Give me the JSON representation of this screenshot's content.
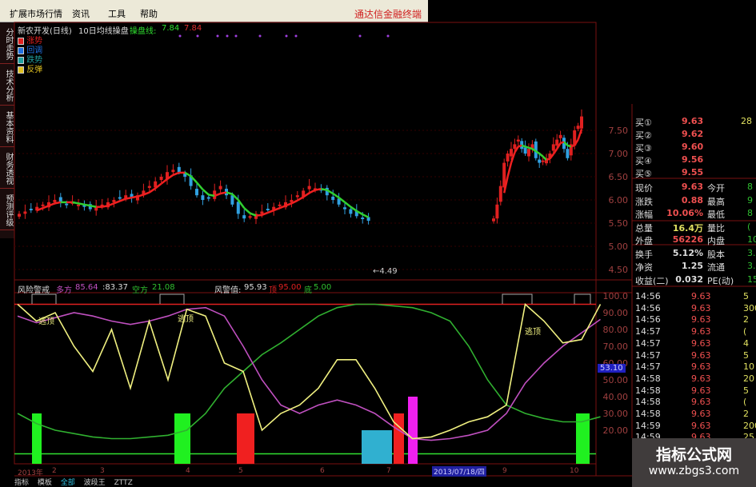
{
  "menu": {
    "items": [
      "扩展市场行情",
      "资讯",
      "工具",
      "帮助"
    ],
    "brand": "通达信金融终端"
  },
  "sidebar": {
    "tabs": [
      "分时走势",
      "技术分析",
      "基本资料",
      "财务透视",
      "预测评级"
    ]
  },
  "main_chart": {
    "title": "新农开发(日线)",
    "indicator": "10日均线操盘",
    "line_label": "操盘线:",
    "line_value": "7.84",
    "line_value2": "7.84",
    "legend": [
      {
        "label": "涨势",
        "color": "#e02020"
      },
      {
        "label": "回调",
        "color": "#2070e0"
      },
      {
        "label": "跌势",
        "color": "#20a0a0"
      },
      {
        "label": "反弹",
        "color": "#e0c020"
      }
    ],
    "price_ticks": [
      "7.50",
      "7.00",
      "6.50",
      "6.00",
      "5.50",
      "5.00",
      "4.50"
    ],
    "low_marker": "←4.49"
  },
  "indicator_panel": {
    "name": "风险警戒",
    "bull_label": "多方",
    "bull_value": "85.64",
    "v2": ":83.37",
    "bear_label": "空方",
    "bear_value": "21.08",
    "warn_label": "风警值:",
    "warn_value": "95.93",
    "top_label": "顶",
    "top_value": "95.00",
    "bottom_label": "底",
    "bottom_value": "5.00",
    "annot": [
      "逃顶",
      "逃顶",
      "逃顶"
    ],
    "y_ticks": [
      "100.0",
      "90.00",
      "80.00",
      "70.00",
      "60.00",
      "50.00",
      "40.00",
      "30.00",
      "20.00"
    ],
    "cursor_value": "53.10"
  },
  "x_axis": {
    "labels": [
      "2013年",
      "2",
      "3",
      "4",
      "5",
      "6",
      "7",
      "9",
      "10"
    ],
    "cursor_date": "2013/07/18/四"
  },
  "bottom_tabs": [
    "指标",
    "模板",
    "全部",
    "波段王",
    "ZTTZ"
  ],
  "chart_data": {
    "type": "candlestick+line",
    "segment1_closes": [
      5.7,
      5.75,
      5.8,
      5.85,
      5.9,
      5.95,
      6.0,
      5.95,
      5.9,
      5.95,
      5.9,
      5.85,
      5.8,
      5.85,
      5.9,
      5.95,
      6.0,
      6.05,
      6.1,
      6.05,
      6.1,
      6.2,
      6.3,
      6.4,
      6.5,
      6.6,
      6.65,
      6.6,
      6.5,
      6.3,
      6.1,
      6.0,
      6.05,
      6.2,
      6.3,
      6.1,
      5.9,
      5.7,
      5.6,
      5.65,
      5.7,
      5.75,
      5.8,
      5.85,
      5.9,
      5.95,
      6.0,
      6.1,
      6.2,
      6.3,
      6.25,
      6.2,
      6.1,
      6.0,
      5.9,
      5.8,
      5.7,
      5.65,
      5.6,
      5.55
    ],
    "segment2_closes": [
      5.6,
      5.9,
      6.3,
      6.8,
      7.0,
      7.1,
      7.2,
      7.3,
      7.1,
      7.0,
      7.1,
      7.2,
      6.9,
      6.8,
      6.85,
      6.9,
      7.0,
      7.2,
      7.3,
      7.4,
      7.1,
      6.9,
      7.2,
      7.5,
      7.6,
      7.8
    ],
    "yellow": [
      95,
      85,
      90,
      70,
      55,
      80,
      45,
      85,
      50,
      92,
      88,
      60,
      55,
      20,
      30,
      35,
      45,
      62,
      62,
      45,
      25,
      15,
      16,
      20,
      25,
      28,
      35,
      95,
      85,
      72,
      74,
      95
    ],
    "purple": [
      88,
      84,
      87,
      90,
      88,
      85,
      83,
      85,
      88,
      92,
      93,
      88,
      70,
      50,
      35,
      30,
      35,
      38,
      35,
      30,
      22,
      15,
      14,
      15,
      17,
      20,
      30,
      48,
      60,
      70,
      78,
      86
    ],
    "green": [
      30,
      24,
      20,
      18,
      16,
      15,
      15,
      16,
      17,
      20,
      30,
      45,
      55,
      65,
      72,
      80,
      88,
      93,
      95,
      95,
      94,
      93,
      90,
      85,
      70,
      50,
      35,
      30,
      27,
      25,
      25,
      28
    ],
    "bars": [
      {
        "color": "#20f020",
        "value": 30
      },
      {
        "color": "#20f020",
        "value": 30
      },
      {
        "color": "#f02020",
        "value": 30
      },
      {
        "color": "#30b0d0",
        "value": 20
      },
      {
        "color": "#f02020",
        "value": 30
      },
      {
        "color": "#f020f0",
        "value": 40
      },
      {
        "color": "#20f020",
        "value": 30
      }
    ],
    "ylim": [
      0,
      100
    ],
    "top_line": 95,
    "bottom_line": 5
  },
  "quote": {
    "bids": [
      {
        "label": "买①",
        "price": "9.63",
        "vol": "28"
      },
      {
        "label": "买②",
        "price": "9.62"
      },
      {
        "label": "买③",
        "price": "9.60"
      },
      {
        "label": "买④",
        "price": "9.56"
      },
      {
        "label": "买⑤",
        "price": "9.55"
      }
    ],
    "stats": [
      {
        "l": "现价",
        "v": "9.63",
        "l2": "今开",
        "v2": "8"
      },
      {
        "l": "涨跌",
        "v": "0.88",
        "l2": "最高",
        "v2": "9"
      },
      {
        "l": "涨幅",
        "v": "10.06%",
        "l2": "最低",
        "v2": "8"
      },
      {
        "l": "总量",
        "v": "16.4万",
        "l2": "量比",
        "v2": "("
      },
      {
        "l": "外盘",
        "v": "56226",
        "l2": "内盘",
        "v2": "10."
      },
      {
        "l": "换手",
        "v": "5.12%",
        "l2": "股本",
        "v2": "3.2"
      },
      {
        "l": "净资",
        "v": "1.25",
        "l2": "流通",
        "v2": "3.2"
      },
      {
        "l": "收益(二)",
        "v": "0.032",
        "l2": "PE(动)",
        "v2": "15"
      }
    ],
    "ticks": [
      {
        "t": "14:56",
        "p": "9.63",
        "v": "5"
      },
      {
        "t": "14:56",
        "p": "9.63",
        "v": "300"
      },
      {
        "t": "14:56",
        "p": "9.63",
        "v": "2"
      },
      {
        "t": "14:57",
        "p": "9.63",
        "v": "("
      },
      {
        "t": "14:57",
        "p": "9.63",
        "v": "4"
      },
      {
        "t": "14:57",
        "p": "9.63",
        "v": "5"
      },
      {
        "t": "14:57",
        "p": "9.63",
        "v": "10"
      },
      {
        "t": "14:58",
        "p": "9.63",
        "v": "20"
      },
      {
        "t": "14:58",
        "p": "9.63",
        "v": "5"
      },
      {
        "t": "14:58",
        "p": "9.63",
        "v": "("
      },
      {
        "t": "14:58",
        "p": "9.63",
        "v": "2"
      },
      {
        "t": "14:59",
        "p": "9.63",
        "v": "200"
      },
      {
        "t": "14:59",
        "p": "9.63",
        "v": "25"
      }
    ]
  },
  "watermark": {
    "title": "指标公式网",
    "url": "www.zbgs3.com"
  },
  "colors": {
    "up": "#e02020",
    "down": "#30a0e0",
    "grid": "#7a1010",
    "yellow": "#f0f080",
    "purple": "#c050c0",
    "green": "#30b030"
  }
}
